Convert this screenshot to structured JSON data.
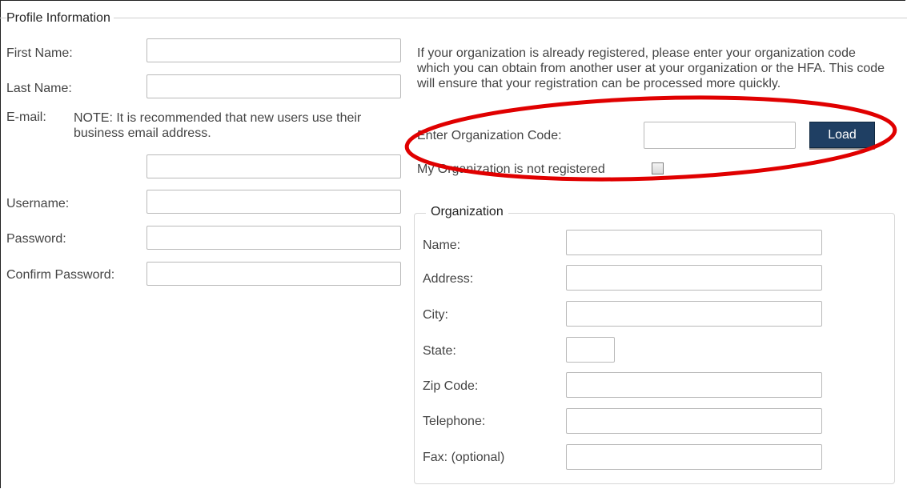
{
  "profile": {
    "legend": "Profile Information",
    "first_name_label": "First Name:",
    "last_name_label": "Last Name:",
    "email_label": "E-mail:",
    "email_note": "NOTE: It is recommended that new users use their business email address.",
    "username_label": "Username:",
    "password_label": "Password:",
    "confirm_password_label": "Confirm Password:"
  },
  "org_code": {
    "info": "If your organization is already registered, please enter your organization code which you can obtain from another user at your organization or the HFA. This code will ensure that your registration can be processed more quickly.",
    "label": "Enter Organization Code:",
    "load_button": "Load",
    "not_registered_label": "My Organization is not registered"
  },
  "organization": {
    "legend": "Organization",
    "name_label": "Name:",
    "address_label": "Address:",
    "city_label": "City:",
    "state_label": "State:",
    "zip_label": "Zip Code:",
    "telephone_label": "Telephone:",
    "fax_label": "Fax: (optional)"
  },
  "colors": {
    "button_bg": "#1f3f63",
    "annotation": "#e00000",
    "border": "#b9b9b9"
  }
}
